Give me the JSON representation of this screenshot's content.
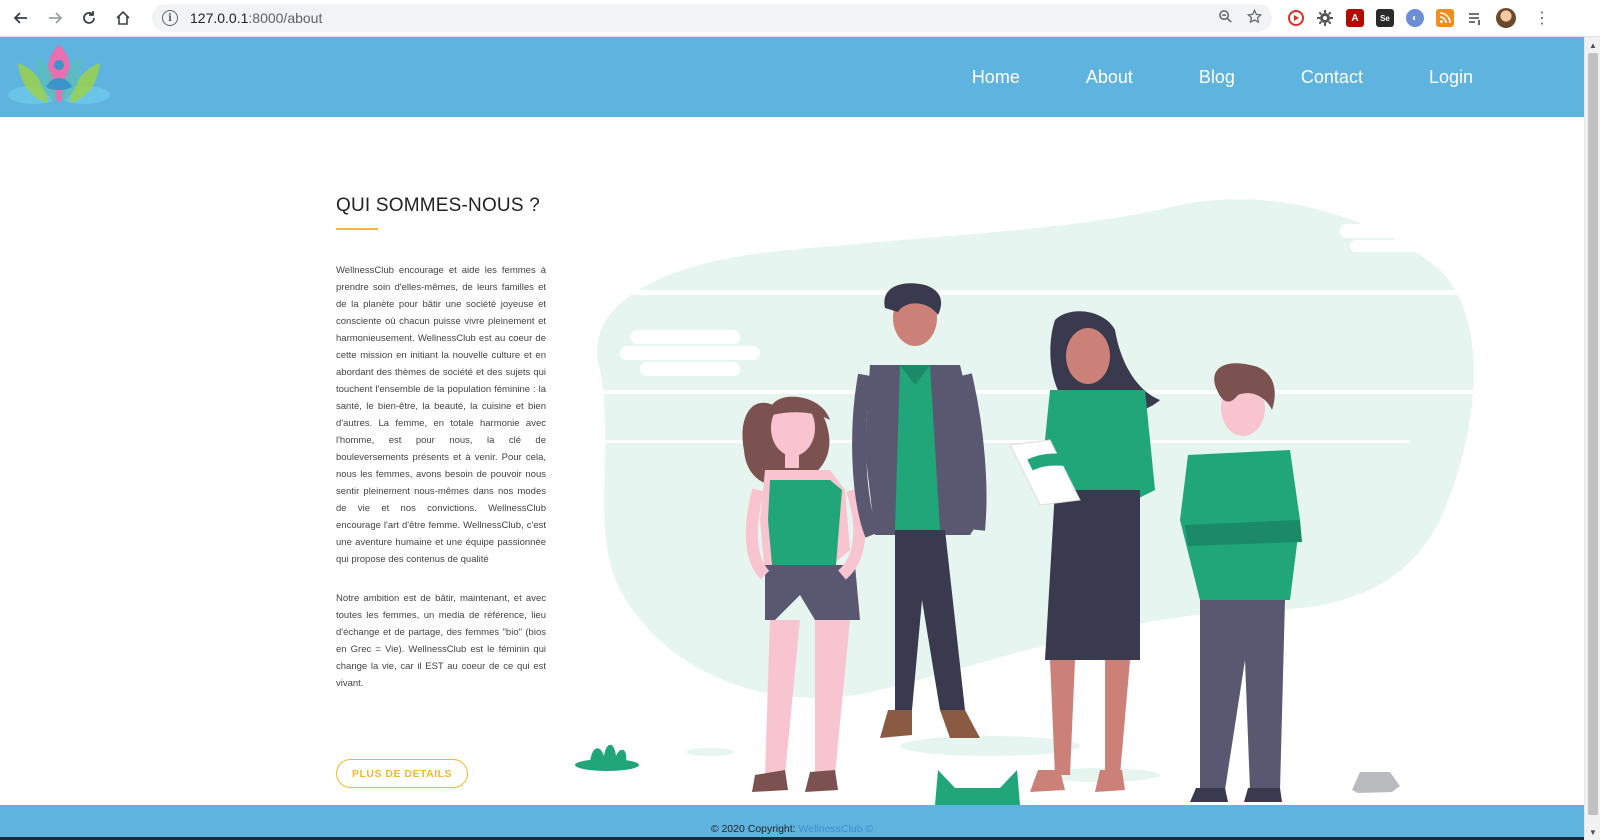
{
  "browser": {
    "url_host": "127.0.0.1",
    "url_rest": ":8000/about",
    "nav_icons": [
      "back-icon",
      "forward-icon",
      "reload-icon",
      "home-icon"
    ],
    "extension_icons": [
      "shield-icon",
      "gear-extension-icon",
      "pdf-icon",
      "se-icon",
      "translate-icon",
      "rss-icon",
      "playlist-icon"
    ]
  },
  "header": {
    "logo": "lotus-logo",
    "nav": [
      "Home",
      "About",
      "Blog",
      "Contact",
      "Login"
    ]
  },
  "about": {
    "title": "QUI SOMMES-NOUS ?",
    "paragraph1": "WellnessClub encourage et aide les femmes à prendre soin d'elles-mêmes, de leurs familles et de la planète pour bâtir une société joyeuse et consciente où chacun puisse vivre pleinement et harmonieusement. WellnessClub est au coeur de cette mission en initiant la nouvelle culture et en abordant des thèmes de société et des sujets qui touchent l'ensemble de la population féminine : la santé, le bien-être, la beauté, la cuisine et bien d'autres. La femme, en totale harmonie avec l'homme, est pour nous, la clé de bouleversements présents et à venir. Pour cela, nous les femmes, avons besoin de pouvoir nous sentir pleinement nous-mêmes dans nos modes de vie et nos convictions. WellnessClub encourage l'art d'être femme. WellnessClub, c'est une aventure humaine et une équipe passionnée qui propose des contenus de qualité",
    "paragraph2": "Notre ambition est de bâtir, maintenant, et avec toutes les femmes, un media de référence, lieu d'échange et de partage, des femmes \"bio\" (bios en Grec = Vie). WellnessClub est le féminin qui change la vie, car il EST au coeur de ce qui est vivant.",
    "button": "PLUS DE DETAILS"
  },
  "footer": {
    "copyright": "© 2020 Copyright:",
    "brand": "WellnessClub ©"
  },
  "colors": {
    "header_bg": "#5eb3df",
    "accent": "#f1b82d",
    "green": "#21a67a",
    "footer_link": "#3d8fd0"
  }
}
